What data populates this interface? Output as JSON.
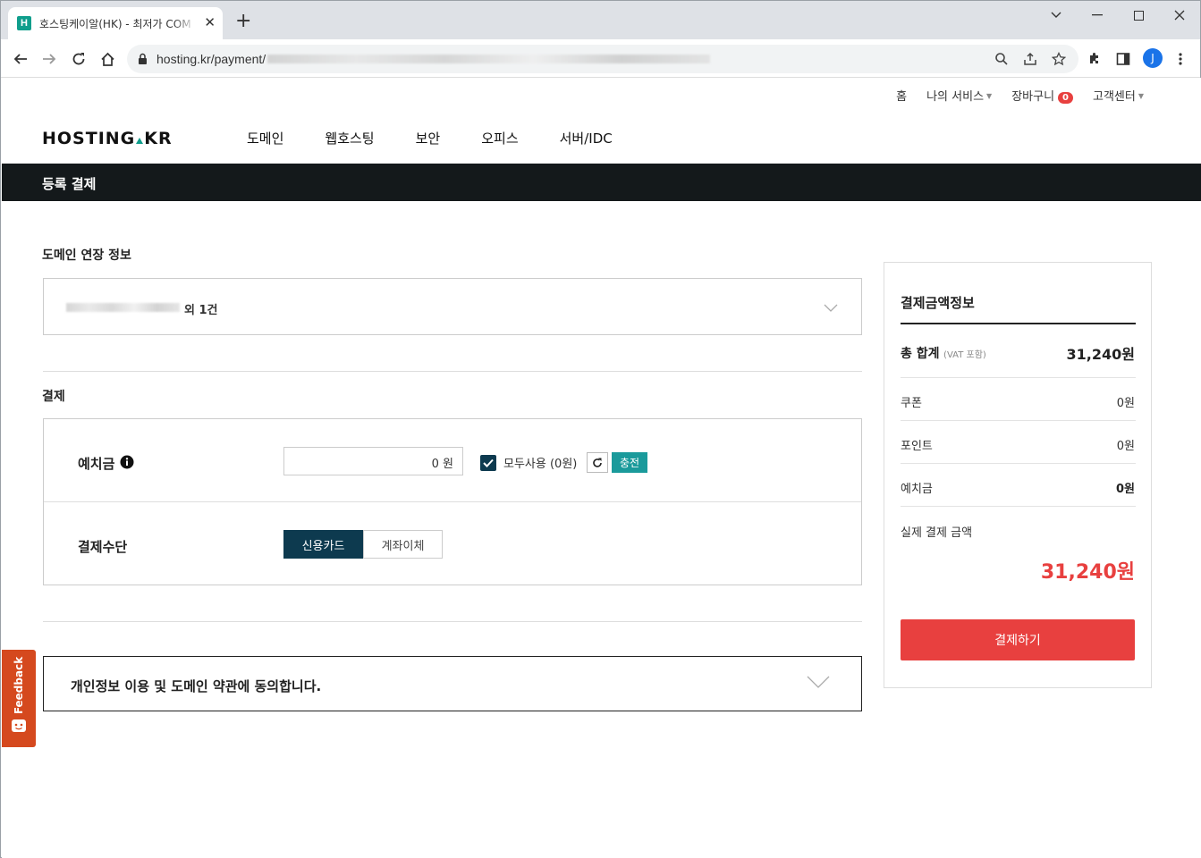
{
  "browser": {
    "tab_title": "호스팅케이알(HK) - 최저가 COM",
    "favicon_letter": "H",
    "url": "hosting.kr/payment/",
    "profile_initial": "J"
  },
  "site": {
    "logo": "HOSTING.KR",
    "top_menu": {
      "home": "홈",
      "my_service": "나의 서비스",
      "cart": "장바구니",
      "cart_count": "0",
      "support": "고객센터"
    },
    "main_nav": [
      "도메인",
      "웹호스팅",
      "보안",
      "오피스",
      "서버/IDC"
    ]
  },
  "page": {
    "title": "등록 결제",
    "domain_section_title": "도메인 연장 정보",
    "domain_summary_suffix": "외 1건",
    "payment_section_title": "결제",
    "deposit_label": "예치금",
    "deposit_value": "0 원",
    "use_all_label": "모두사용 (0원)",
    "charge_button": "충전",
    "method_label": "결제수단",
    "method_card": "신용카드",
    "method_transfer": "계좌이체",
    "terms_label": "개인정보 이용 및 도메인 약관에 동의합니다."
  },
  "summary": {
    "title": "결제금액정보",
    "total_label": "총 합계",
    "total_note": "(VAT 포함)",
    "total_value": "31,240원",
    "coupon_label": "쿠폰",
    "coupon_value": "0원",
    "point_label": "포인트",
    "point_value": "0원",
    "deposit_label": "예치금",
    "deposit_value": "0원",
    "actual_label": "실제 결제 금액",
    "actual_value": "31,240원",
    "pay_button": "결제하기"
  },
  "feedback": {
    "label": "Feedback"
  },
  "colors": {
    "accent_red": "#e8403f",
    "dark_nav": "#14191b",
    "teal": "#1a9a9b",
    "navy": "#0d3a4f"
  }
}
